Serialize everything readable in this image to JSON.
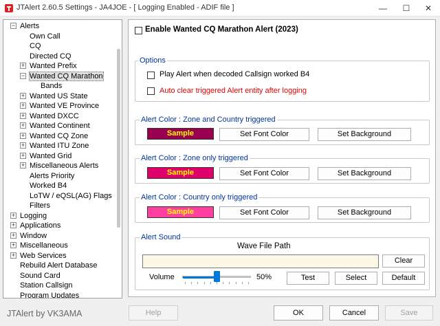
{
  "window": {
    "title": "JTAlert 2.60.5 Settings  -  JA4JOE  -  [ Logging Enabled - ADIF file ]",
    "minimize": "—",
    "maximize": "☐",
    "close": "✕"
  },
  "tree": {
    "root_alerts": "Alerts",
    "alerts_children": [
      "Own Call",
      "CQ",
      "Directed CQ",
      "Wanted Prefix",
      "Wanted CQ Marathon",
      "Bands",
      "Wanted US State",
      "Wanted VE Province",
      "Wanted DXCC",
      "Wanted Continent",
      "Wanted CQ Zone",
      "Wanted ITU Zone",
      "Wanted Grid",
      "Miscellaneous Alerts",
      "Alerts Priority",
      "Worked B4",
      "LoTW / eQSL(AG) Flags",
      "Filters"
    ],
    "other_roots": [
      "Logging",
      "Applications",
      "Window",
      "Miscellaneous",
      "Web Services",
      "Rebuild Alert Database",
      "Sound Card",
      "Station Callsign",
      "Program Updates"
    ],
    "selected": "Wanted CQ Marathon"
  },
  "panel": {
    "enable_label": "Enable Wanted CQ Marathon Alert (2023)",
    "enable_checked": false,
    "options": {
      "title": "Options",
      "play_alert_label": "Play Alert when decoded Callsign worked B4",
      "auto_clear_label": "Auto clear triggered Alert entity after logging"
    },
    "color_groups": [
      {
        "title": "Alert Color : Zone and Country triggered",
        "sample": "Sample",
        "bg": "#990050",
        "font_btn": "Set Font Color",
        "bg_btn": "Set Background"
      },
      {
        "title": "Alert Color : Zone only triggered",
        "sample": "Sample",
        "bg": "#e0006a",
        "font_btn": "Set Font Color",
        "bg_btn": "Set Background"
      },
      {
        "title": "Alert Color : Country only triggered",
        "sample": "Sample",
        "bg": "#ff40a0",
        "font_btn": "Set Font Color",
        "bg_btn": "Set Background"
      }
    ],
    "sound": {
      "title": "Alert Sound",
      "wave_path_label": "Wave File Path",
      "wave_path_value": "",
      "clear_btn": "Clear",
      "volume_label": "Volume",
      "volume_value": 50,
      "volume_text": "50%",
      "test_btn": "Test",
      "select_btn": "Select",
      "default_btn": "Default"
    }
  },
  "footer": {
    "brand": "JTAlert by VK3AMA",
    "help": "Help",
    "ok": "OK",
    "cancel": "Cancel",
    "save": "Save"
  },
  "colors": {
    "group_title": "#003399",
    "red_option": "#e00000",
    "sample_text": "#ffff00",
    "accent": "#0078d7"
  }
}
